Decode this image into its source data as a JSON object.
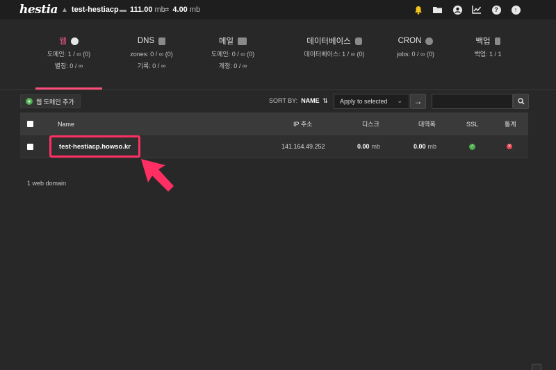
{
  "app": {
    "logo": "hestia"
  },
  "user": {
    "name": "test-hestiacp",
    "disk_value": "111.00",
    "disk_unit": "mb",
    "bandwidth_value": "4.00",
    "bandwidth_unit": "mb"
  },
  "top_icons": [
    "bell-icon",
    "folder-icon",
    "user-icon",
    "stats-icon",
    "help-icon",
    "upload-icon"
  ],
  "tabs": [
    {
      "label": "웹",
      "icon": "globe-icon",
      "line1": "도메인: 1 / ∞ (0)",
      "line2": "별칭: 0 / ∞",
      "active": true
    },
    {
      "label": "DNS",
      "icon": "book-icon",
      "line1": "zones: 0 / ∞ (0)",
      "line2": "기록: 0 / ∞",
      "active": false
    },
    {
      "label": "메일",
      "icon": "mail-icon",
      "line1": "도메인: 0 / ∞ (0)",
      "line2": "계정: 0 / ∞",
      "active": false
    },
    {
      "label": "데이터베이스",
      "icon": "database-icon",
      "line1": "데이터베이스: 1 / ∞ (0)",
      "line2": "",
      "active": false
    },
    {
      "label": "CRON",
      "icon": "clock-icon",
      "line1": "jobs: 0 / ∞ (0)",
      "line2": "",
      "active": false
    },
    {
      "label": "백업",
      "icon": "file-icon",
      "line1": "백업: 1 / 1",
      "line2": "",
      "active": false
    }
  ],
  "toolbar": {
    "add_label": "웹 도메인 추가",
    "sort_by_label": "SORT BY:",
    "sort_value": "NAME",
    "apply_label": "Apply to selected",
    "go_label": "→",
    "search_placeholder": ""
  },
  "table": {
    "headers": {
      "name": "Name",
      "ip": "IP 주소",
      "disk": "디스크",
      "bandwidth": "대역폭",
      "ssl": "SSL",
      "stats": "통계"
    },
    "rows": [
      {
        "name": "test-hestiacp.howso.kr",
        "ip": "141.164.49.252",
        "disk_value": "0.00",
        "disk_unit": "mb",
        "bandwidth_value": "0.00",
        "bandwidth_unit": "mb",
        "ssl": true,
        "stats": false
      }
    ]
  },
  "footer": {
    "count": "1 web domain"
  },
  "colors": {
    "accent": "#ff4b7a",
    "highlight": "#ff2e63",
    "success": "#4caf50",
    "danger": "#e8474e"
  }
}
